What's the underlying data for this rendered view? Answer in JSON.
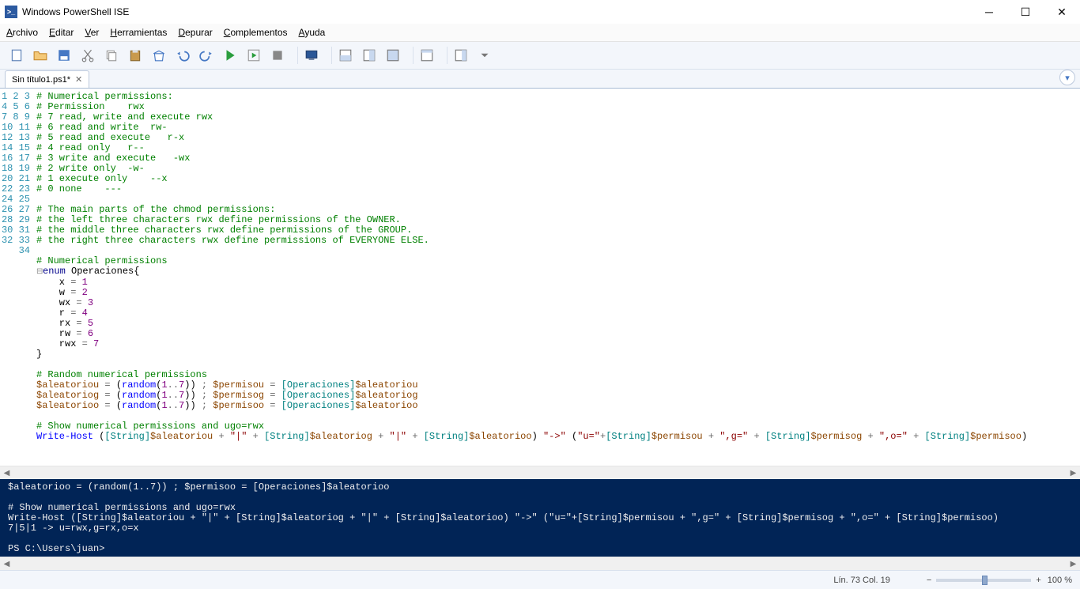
{
  "window": {
    "title": "Windows PowerShell ISE"
  },
  "menubar": {
    "items": [
      "Archivo",
      "Editar",
      "Ver",
      "Herramientas",
      "Depurar",
      "Complementos",
      "Ayuda"
    ]
  },
  "toolbar": {
    "icons": [
      "new",
      "open",
      "save",
      "cut",
      "copy",
      "paste",
      "clear",
      "undo",
      "redo",
      "run",
      "run-selection",
      "stop",
      "sep",
      "remote",
      "sep",
      "layout-script-bottom",
      "layout-script-right",
      "layout-script-max",
      "sep",
      "cmd-pane",
      "sep",
      "toggle-panel",
      "dropdown"
    ]
  },
  "tab": {
    "label": "Sin título1.ps1*"
  },
  "gutter": {
    "start": 1,
    "end": 34
  },
  "code_lines": [
    {
      "raw": "# Numerical permissions:",
      "cls": "c-com"
    },
    {
      "raw": "# Permission    rwx",
      "cls": "c-com"
    },
    {
      "raw": "# 7 read, write and execute rwx",
      "cls": "c-com"
    },
    {
      "raw": "# 6 read and write  rw-",
      "cls": "c-com"
    },
    {
      "raw": "# 5 read and execute   r-x",
      "cls": "c-com"
    },
    {
      "raw": "# 4 read only   r--",
      "cls": "c-com"
    },
    {
      "raw": "# 3 write and execute   -wx",
      "cls": "c-com"
    },
    {
      "raw": "# 2 write only  -w-",
      "cls": "c-com"
    },
    {
      "raw": "# 1 execute only    --x",
      "cls": "c-com"
    },
    {
      "raw": "# 0 none    ---",
      "cls": "c-com"
    },
    {
      "raw": " ",
      "cls": ""
    },
    {
      "raw": "# The main parts of the chmod permissions:",
      "cls": "c-com"
    },
    {
      "raw": "# the left three characters rwx define permissions of the OWNER.",
      "cls": "c-com"
    },
    {
      "raw": "# the middle three characters rwx define permissions of the GROUP.",
      "cls": "c-com"
    },
    {
      "raw": "# the right three characters rwx define permissions of EVERYONE ELSE.",
      "cls": "c-com"
    },
    {
      "raw": " ",
      "cls": ""
    },
    {
      "raw": "# Numerical permissions",
      "cls": "c-com"
    },
    {
      "html": "<span class='c-fold'>⊟</span><span class='c-kw'>enum</span> <span class='c-id'>Operaciones</span>{"
    },
    {
      "html": "    x <span class='c-op'>=</span> <span class='c-num'>1</span>"
    },
    {
      "html": "    w <span class='c-op'>=</span> <span class='c-num'>2</span>"
    },
    {
      "html": "    wx <span class='c-op'>=</span> <span class='c-num'>3</span>"
    },
    {
      "html": "    r <span class='c-op'>=</span> <span class='c-num'>4</span>"
    },
    {
      "html": "    rx <span class='c-op'>=</span> <span class='c-num'>5</span>"
    },
    {
      "html": "    rw <span class='c-op'>=</span> <span class='c-num'>6</span>"
    },
    {
      "html": "    rwx <span class='c-op'>=</span> <span class='c-num'>7</span>"
    },
    {
      "raw": "}",
      "cls": ""
    },
    {
      "raw": " ",
      "cls": ""
    },
    {
      "raw": "# Random numerical permissions",
      "cls": "c-com"
    },
    {
      "html": "<span class='c-var'>$aleatoriou</span> <span class='c-op'>=</span> (<span class='c-cmd'>random</span>(<span class='c-num'>1</span><span class='c-op'>..</span><span class='c-num'>7</span>)) <span class='c-op'>;</span> <span class='c-var'>$permisou</span> <span class='c-op'>=</span> <span class='c-type'>[Operaciones]</span><span class='c-var'>$aleatoriou</span>"
    },
    {
      "html": "<span class='c-var'>$aleatoriog</span> <span class='c-op'>=</span> (<span class='c-cmd'>random</span>(<span class='c-num'>1</span><span class='c-op'>..</span><span class='c-num'>7</span>)) <span class='c-op'>;</span> <span class='c-var'>$permisog</span> <span class='c-op'>=</span> <span class='c-type'>[Operaciones]</span><span class='c-var'>$aleatoriog</span>"
    },
    {
      "html": "<span class='c-var'>$aleatorioo</span> <span class='c-op'>=</span> (<span class='c-cmd'>random</span>(<span class='c-num'>1</span><span class='c-op'>..</span><span class='c-num'>7</span>)) <span class='c-op'>;</span> <span class='c-var'>$permisoo</span> <span class='c-op'>=</span> <span class='c-type'>[Operaciones]</span><span class='c-var'>$aleatorioo</span>"
    },
    {
      "raw": " ",
      "cls": ""
    },
    {
      "raw": "# Show numerical permissions and ugo=rwx",
      "cls": "c-com"
    },
    {
      "html": "<span class='c-cmd'>Write-Host</span> (<span class='c-type'>[String]</span><span class='c-var'>$aleatoriou</span> <span class='c-op'>+</span> <span class='c-str'>\"|\"</span> <span class='c-op'>+</span> <span class='c-type'>[String]</span><span class='c-var'>$aleatoriog</span> <span class='c-op'>+</span> <span class='c-str'>\"|\"</span> <span class='c-op'>+</span> <span class='c-type'>[String]</span><span class='c-var'>$aleatorioo</span>) <span class='c-str'>\"->\"</span> (<span class='c-str'>\"u=\"</span><span class='c-op'>+</span><span class='c-type'>[String]</span><span class='c-var'>$permisou</span> <span class='c-op'>+</span> <span class='c-str'>\",g=\"</span> <span class='c-op'>+</span> <span class='c-type'>[String]</span><span class='c-var'>$permisog</span> <span class='c-op'>+</span> <span class='c-str'>\",o=\"</span> <span class='c-op'>+</span> <span class='c-type'>[String]</span><span class='c-var'>$permisoo</span>)"
    }
  ],
  "console_lines": [
    "$aleatorioo = (random(1..7)) ; $permisoo = [Operaciones]$aleatorioo",
    "",
    "# Show numerical permissions and ugo=rwx",
    "Write-Host ([String]$aleatoriou + \"|\" + [String]$aleatoriog + \"|\" + [String]$aleatorioo) \"->\" (\"u=\"+[String]$permisou + \",g=\" + [String]$permisog + \",o=\" + [String]$permisoo)",
    "7|5|1 -> u=rwx,g=rx,o=x",
    "",
    "PS C:\\Users\\juan> "
  ],
  "statusbar": {
    "cursor": "Lín. 73  Col. 19",
    "zoom": "100 %"
  }
}
